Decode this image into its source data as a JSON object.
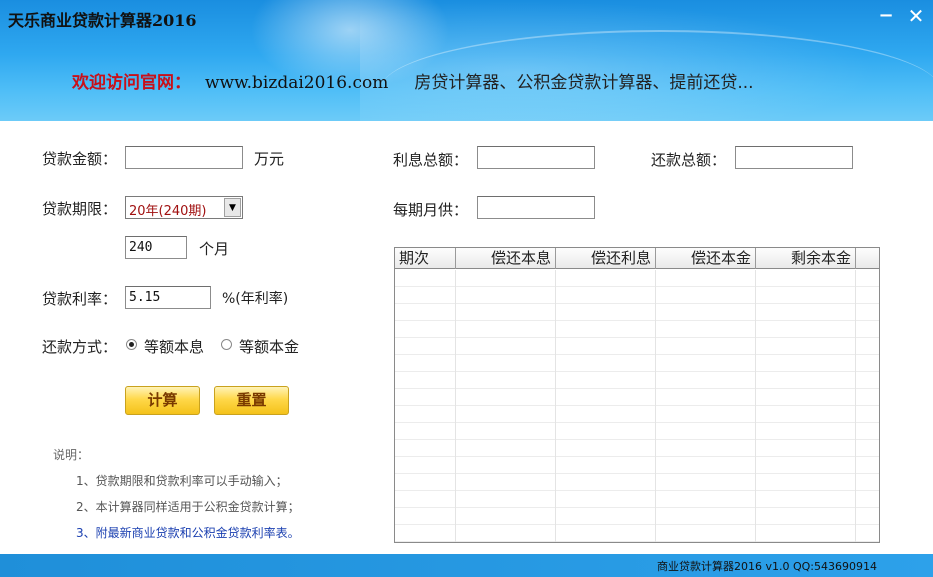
{
  "window": {
    "title": "天乐商业贷款计算器2016",
    "minimize_glyph": "−",
    "close_glyph": "✕"
  },
  "banner": {
    "label": "欢迎访问官网：",
    "url": "www.bizdai2016.com",
    "links": "房贷计算器、公积金贷款计算器、提前还贷..."
  },
  "form": {
    "amount": {
      "label": "贷款金额：",
      "value": "",
      "unit": "万元"
    },
    "term": {
      "label": "贷款期限：",
      "selected": "20年(240期)",
      "months_value": "240",
      "months_unit": "个月"
    },
    "rate": {
      "label": "贷款利率：",
      "value": "5.15",
      "unit": "%(年利率)"
    },
    "method": {
      "label": "还款方式：",
      "options": [
        {
          "label": "等额本息",
          "selected": true
        },
        {
          "label": "等额本金",
          "selected": false
        }
      ]
    },
    "calc_button": "计算",
    "reset_button": "重置"
  },
  "results": {
    "interest_total": {
      "label": "利息总额：",
      "value": ""
    },
    "repay_total": {
      "label": "还款总额：",
      "value": ""
    },
    "monthly": {
      "label": "每期月供：",
      "value": ""
    }
  },
  "table": {
    "columns": [
      "期次",
      "偿还本息",
      "偿还利息",
      "偿还本金",
      "剩余本金"
    ],
    "rows": []
  },
  "notes": {
    "heading": "说明：",
    "items": [
      {
        "text": "1、贷款期限和贷款利率可以手动输入；",
        "color": "#555555"
      },
      {
        "text": "2、本计算器同样适用于公积金贷款计算；",
        "color": "#555555"
      },
      {
        "text": "3、附最新商业贷款和公积金贷款利率表。",
        "color": "#1a3fb0"
      }
    ]
  },
  "status_bar": {
    "text": "商业贷款计算器2016 v1.0 QQ:543690914"
  },
  "colors": {
    "header": "#2fa8f0",
    "accent_red": "#c8101a",
    "button_gold": "#f4c21a"
  }
}
